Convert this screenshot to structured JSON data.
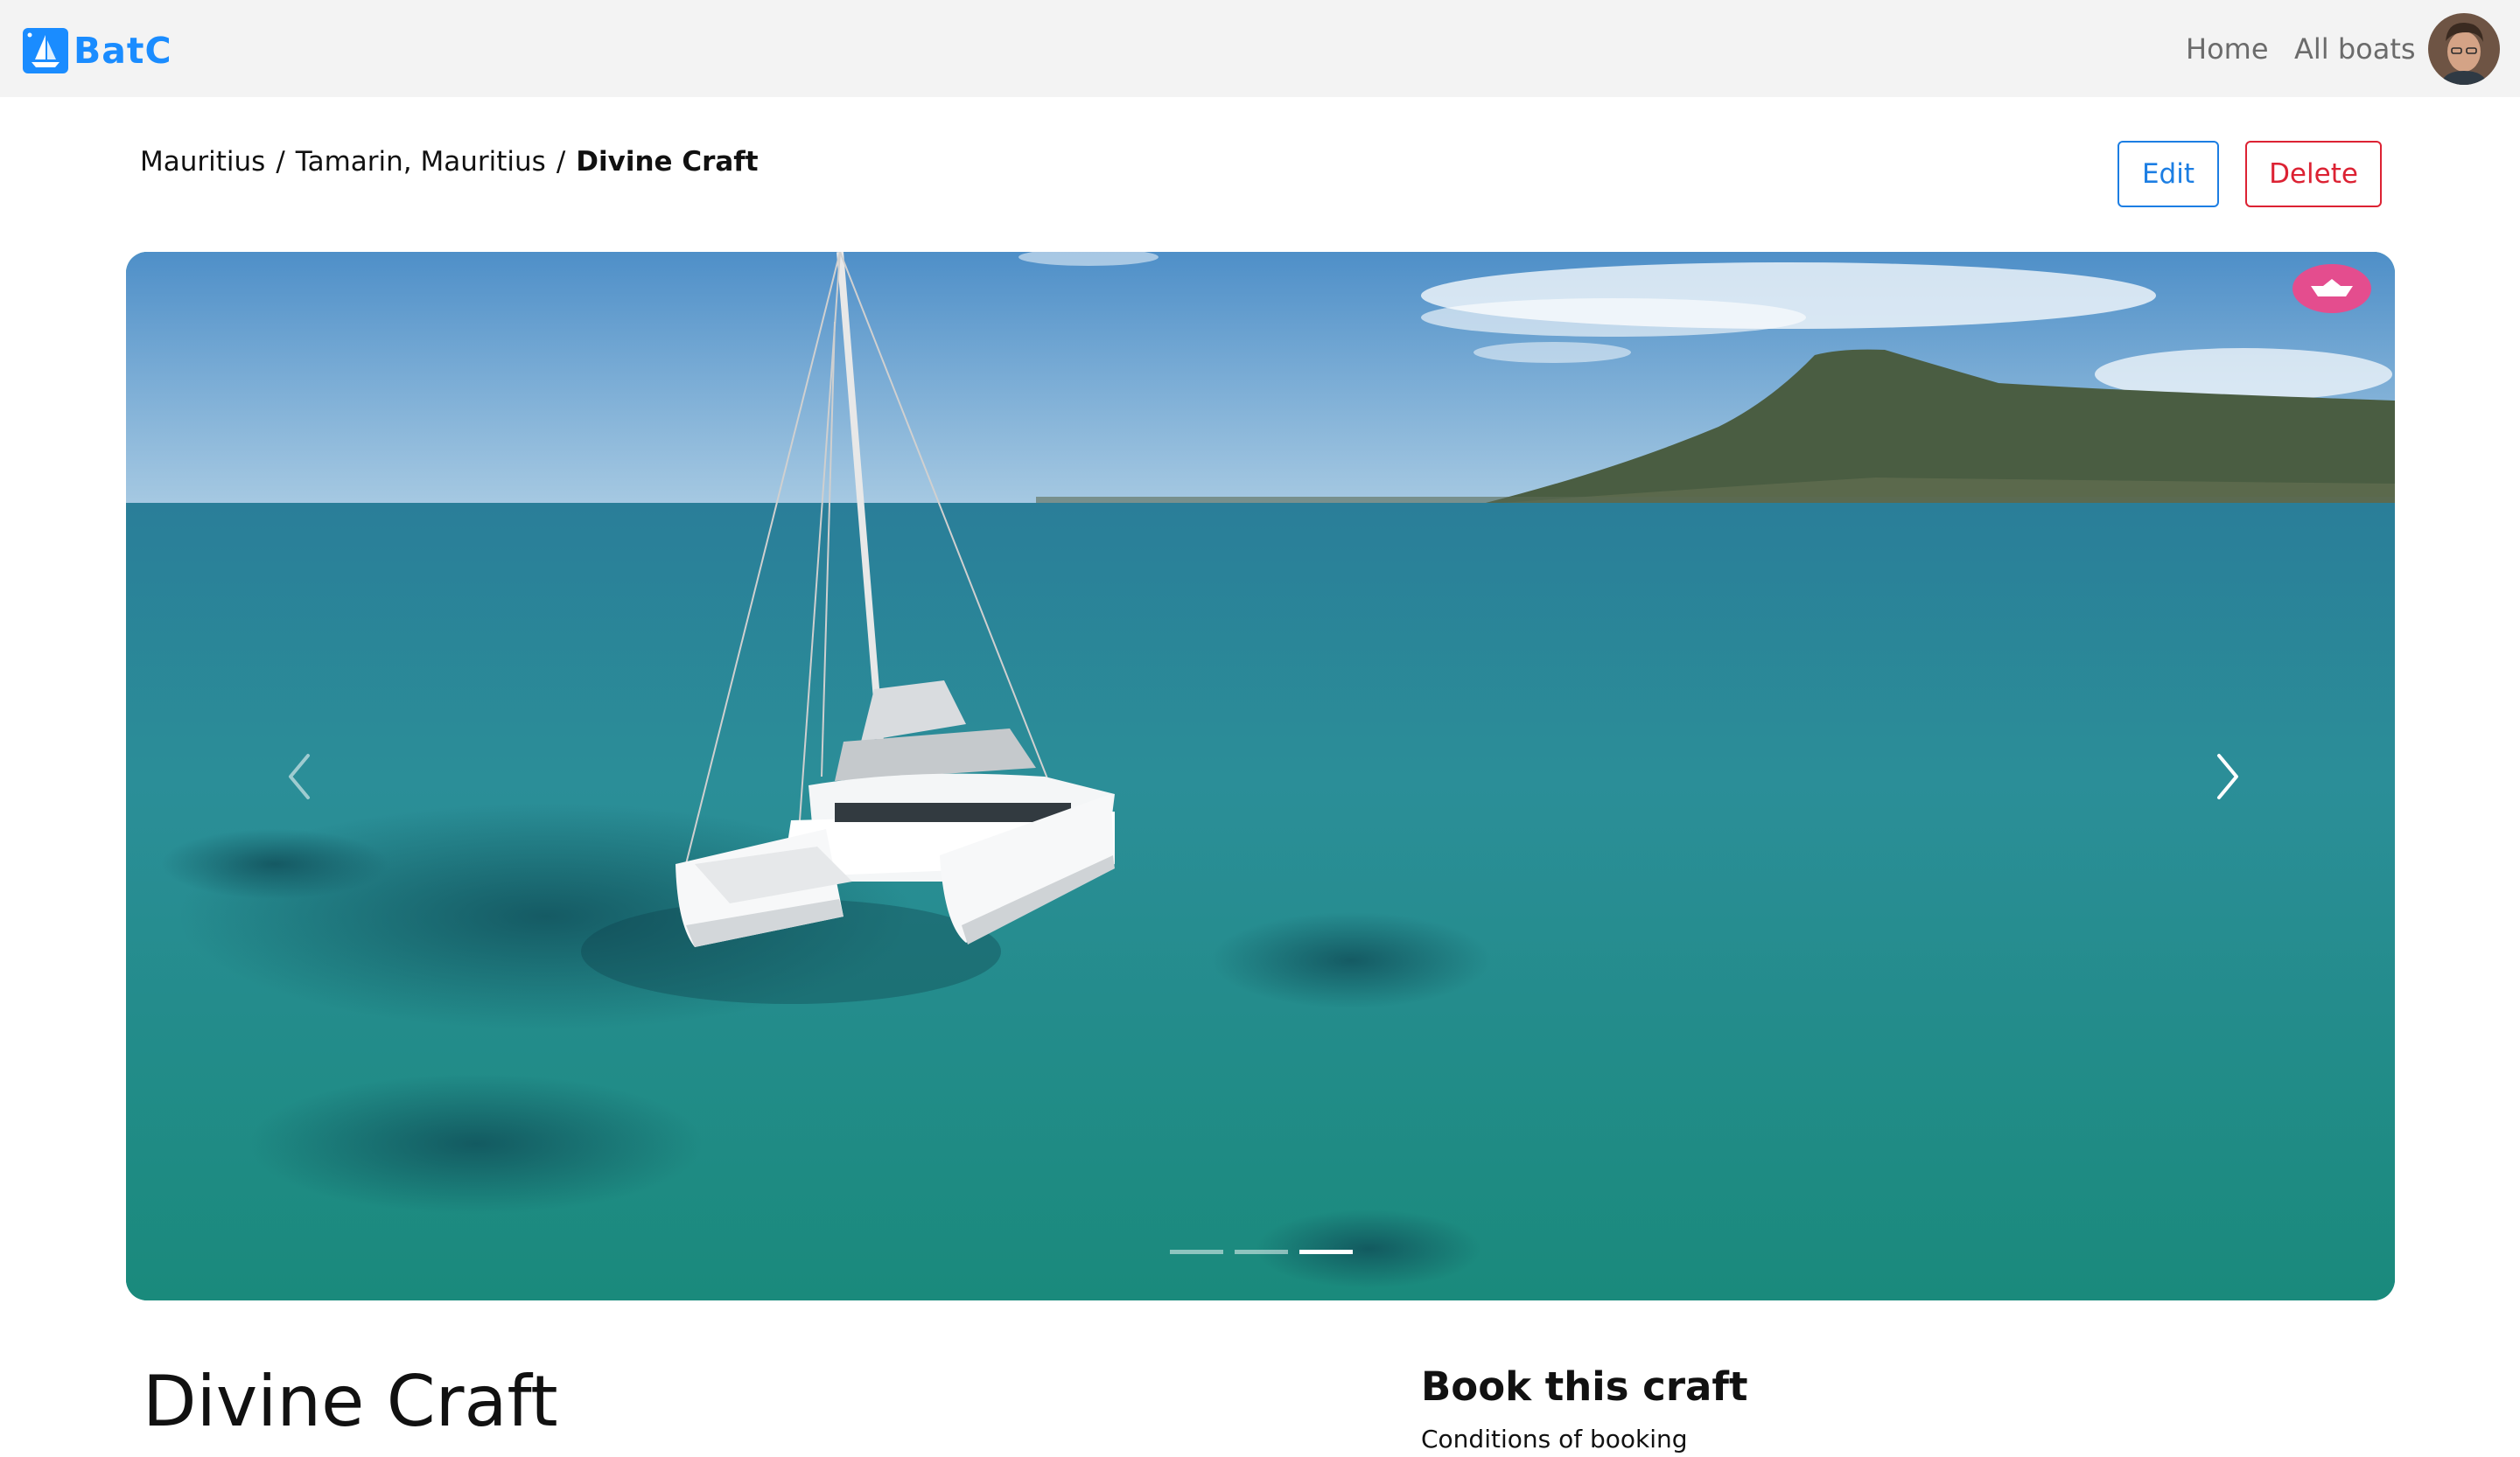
{
  "navbar": {
    "brand": "BatC",
    "links": [
      {
        "label": "Home"
      },
      {
        "label": "All boats"
      }
    ],
    "colors": {
      "brand": "#1a8cff",
      "background": "#f3f3f3",
      "link": "#6b6b6b"
    }
  },
  "breadcrumb": {
    "items": [
      "Mauritius",
      "Tamarin, Mauritius"
    ],
    "separator": "/",
    "current": "Divine Craft"
  },
  "actions": {
    "edit_label": "Edit",
    "delete_label": "Delete",
    "colors": {
      "edit": "#1c7ee3",
      "delete": "#dc2233"
    }
  },
  "carousel": {
    "slide_count": 3,
    "active_index": 2,
    "prev_icon": "chevron-left-icon",
    "next_icon": "chevron-right-icon",
    "favorite_icon": "boat-favorite-icon",
    "favorite_color": "#e44d8e"
  },
  "boat": {
    "title": "Divine Craft"
  },
  "booking": {
    "title": "Book this craft",
    "subtitle": "Conditions of booking"
  }
}
